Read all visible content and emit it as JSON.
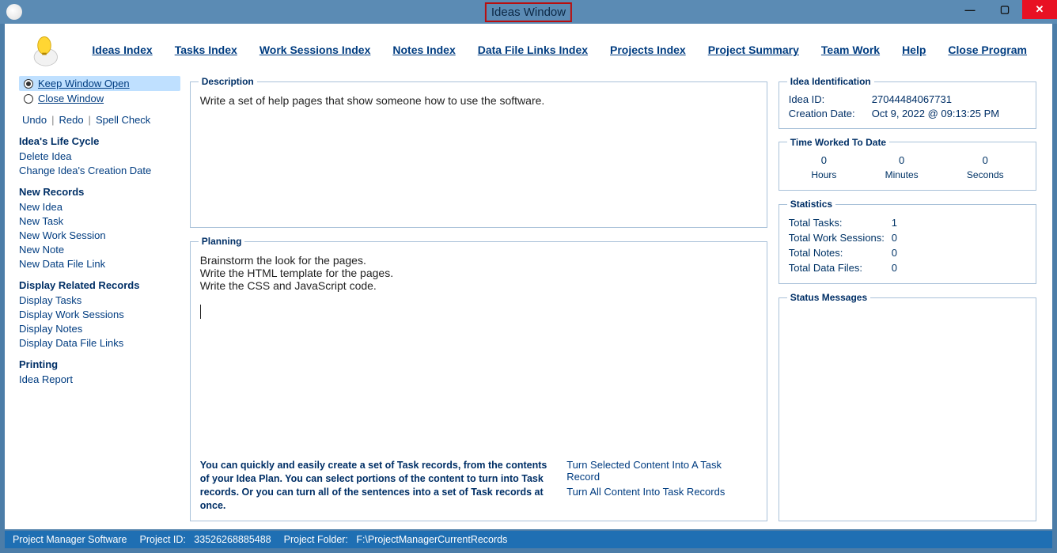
{
  "window": {
    "title": "Ideas Window"
  },
  "menu": {
    "ideas_index": "Ideas Index",
    "tasks_index": "Tasks Index",
    "work_sessions_index": "Work Sessions Index",
    "notes_index": "Notes Index",
    "data_file_links_index": "Data File Links Index",
    "projects_index": "Projects Index",
    "project_summary": "Project Summary",
    "team_work": "Team Work",
    "help": "Help",
    "close_program": "Close Program"
  },
  "sidebar": {
    "radio_keep_open": "Keep Window Open",
    "radio_close": "Close Window",
    "tool_undo": "Undo",
    "tool_redo": "Redo",
    "tool_spell": "Spell Check",
    "sec_lifecycle": "Idea's Life Cycle",
    "lifecycle_delete": "Delete Idea",
    "lifecycle_change_date": "Change Idea's Creation Date",
    "sec_new": "New Records",
    "new_idea": "New Idea",
    "new_task": "New Task",
    "new_work_session": "New Work Session",
    "new_note": "New Note",
    "new_data_file_link": "New Data File Link",
    "sec_display": "Display Related Records",
    "display_tasks": "Display Tasks",
    "display_work_sessions": "Display Work Sessions",
    "display_notes": "Display Notes",
    "display_data_file_links": "Display Data File Links",
    "sec_printing": "Printing",
    "idea_report": "Idea Report"
  },
  "center": {
    "description_legend": "Description",
    "description_text": "Write a set of help pages that show someone how to use the software.",
    "planning_legend": "Planning",
    "planning_text": "Brainstorm the look for the pages.\nWrite the HTML template for the pages.\nWrite the CSS and JavaScript code.",
    "tip_text": "You can quickly and easily create a set of Task records, from the contents of your Idea Plan. You can select portions of the content to turn into Task records. Or you can turn all of the sentences into a set of Task records at once.",
    "link_turn_selected": "Turn Selected Content Into A Task Record",
    "link_turn_all": "Turn All Content Into Task Records"
  },
  "right": {
    "ident_legend": "Idea Identification",
    "idea_id_label": "Idea ID:",
    "idea_id_value": "27044484067731",
    "creation_date_label": "Creation Date:",
    "creation_date_value": "Oct  9, 2022 @ 09:13:25 PM",
    "time_worked_legend": "Time Worked To Date",
    "hours_val": "0",
    "hours_lbl": "Hours",
    "minutes_val": "0",
    "minutes_lbl": "Minutes",
    "seconds_val": "0",
    "seconds_lbl": "Seconds",
    "stats_legend": "Statistics",
    "stat_tasks_label": "Total Tasks:",
    "stat_tasks_val": "1",
    "stat_ws_label": "Total Work Sessions:",
    "stat_ws_val": "0",
    "stat_notes_label": "Total Notes:",
    "stat_notes_val": "0",
    "stat_files_label": "Total Data Files:",
    "stat_files_val": "0",
    "status_legend": "Status Messages"
  },
  "statusbar": {
    "app": "Project Manager Software",
    "project_id_label": "Project ID:",
    "project_id_value": "33526268885488",
    "project_folder_label": "Project Folder:",
    "project_folder_value": "F:\\ProjectManagerCurrentRecords"
  }
}
